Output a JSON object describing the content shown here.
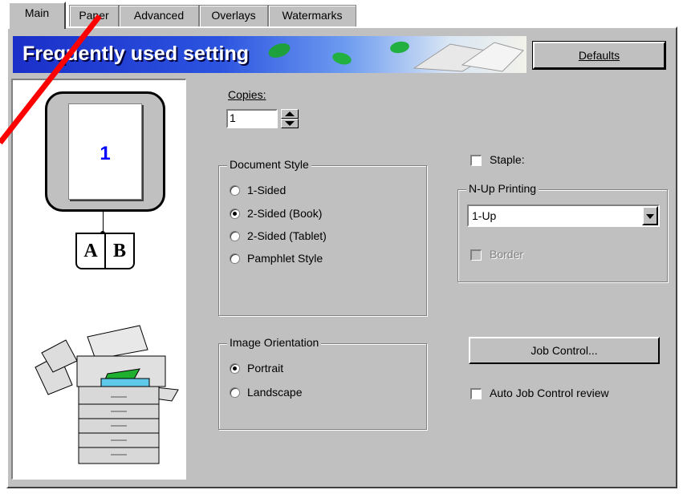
{
  "tabs": [
    {
      "label": "Main",
      "active": true
    },
    {
      "label": "Paper",
      "active": false
    },
    {
      "label": "Advanced",
      "active": false
    },
    {
      "label": "Overlays",
      "active": false
    },
    {
      "label": "Watermarks",
      "active": false
    }
  ],
  "banner": {
    "title": "Frequently used setting"
  },
  "defaults_button": {
    "label": "Defaults"
  },
  "preview": {
    "page_number": "1",
    "book_left": "A",
    "book_right": "B"
  },
  "copies": {
    "label": "Copies:",
    "value": "1"
  },
  "document_style": {
    "title": "Document Style",
    "options": [
      {
        "label": "1-Sided",
        "selected": false
      },
      {
        "label": "2-Sided (Book)",
        "selected": true
      },
      {
        "label": "2-Sided (Tablet)",
        "selected": false
      },
      {
        "label": "Pamphlet Style",
        "selected": false
      }
    ]
  },
  "image_orientation": {
    "title": "Image Orientation",
    "options": [
      {
        "label": "Portrait",
        "selected": true
      },
      {
        "label": "Landscape",
        "selected": false
      }
    ]
  },
  "staple": {
    "label": "Staple:",
    "checked": false
  },
  "nup": {
    "title": "N-Up Printing",
    "selected": "1-Up",
    "border_label": "Border",
    "border_enabled": false
  },
  "job_control_button": {
    "label": "Job Control..."
  },
  "auto_review": {
    "label": "Auto Job Control review",
    "checked": false
  },
  "colors": {
    "face": "#c0c0c0",
    "banner_blue": "#1a2fc8",
    "page_number": "#0000ff",
    "annotation_line": "#ff0000"
  }
}
